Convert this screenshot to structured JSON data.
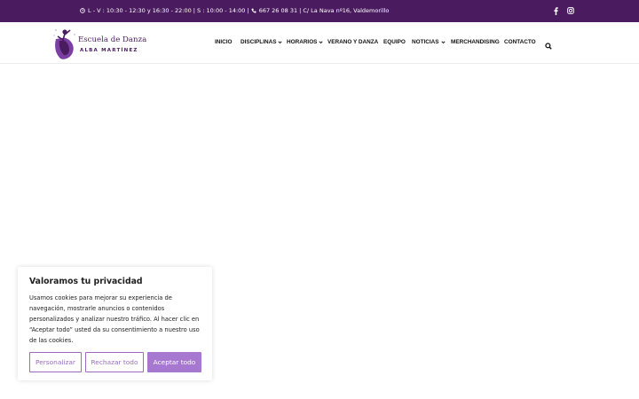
{
  "colors": {
    "topbar": "#4a1b5e",
    "brand": "#4a1b5e",
    "accent": "#a678cf",
    "outline": "#9a6cc2"
  },
  "topbar": {
    "hours": "L - V : 10:30 - 12:30 y 16:30 - 22:00 | S : 10:00 - 14:00 |",
    "phone": "667 26 08 31",
    "address": "| C/ La Nava nº16, Valdemorillo",
    "social": [
      "facebook-icon",
      "instagram-icon"
    ]
  },
  "logo": {
    "line1": "Escuela de Danza",
    "line2": "ALBA MARTÍNEZ"
  },
  "nav": {
    "items": [
      {
        "label": "INICIO",
        "dropdown": false
      },
      {
        "label": "DISCIPLINAS",
        "dropdown": true
      },
      {
        "label": "HORARIOS",
        "dropdown": true
      },
      {
        "label": "VERANO Y DANZA",
        "dropdown": false
      },
      {
        "label": "EQUIPO",
        "dropdown": false
      },
      {
        "label": "NOTICIAS",
        "dropdown": true
      },
      {
        "label": "MERCHANDISING",
        "dropdown": false
      },
      {
        "label": "CONTACTO",
        "dropdown": false
      }
    ],
    "search_icon": "search-icon"
  },
  "cookie": {
    "title": "Valoramos tu privacidad",
    "body": "Usamos cookies para mejorar su experiencia de navegación, mostrarle anuncios o contenidos personalizados y analizar nuestro tráfico. Al hacer clic en “Aceptar todo” usted da su consentimiento a nuestro uso de las cookies.",
    "customize": "Personalizar",
    "reject": "Rechazar todo",
    "accept": "Aceptar todo"
  }
}
